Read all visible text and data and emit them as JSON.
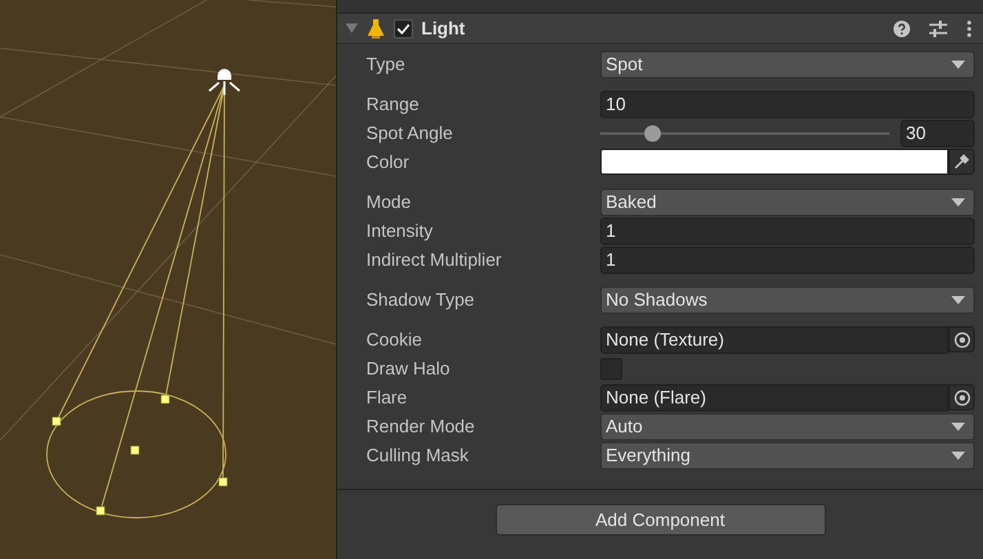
{
  "component": {
    "title": "Light",
    "enabled": true,
    "expanded": true
  },
  "groups": [
    [
      {
        "label": "Type",
        "kind": "dropdown",
        "value": "Spot"
      }
    ],
    [
      {
        "label": "Range",
        "kind": "number",
        "value": "10"
      },
      {
        "label": "Spot Angle",
        "kind": "slider",
        "value": "30",
        "level": 0.18
      },
      {
        "label": "Color",
        "kind": "color",
        "color": "#ffffff"
      }
    ],
    [
      {
        "label": "Mode",
        "kind": "dropdown",
        "value": "Baked"
      },
      {
        "label": "Intensity",
        "kind": "number",
        "value": "1"
      },
      {
        "label": "Indirect Multiplier",
        "kind": "number",
        "value": "1"
      }
    ],
    [
      {
        "label": "Shadow Type",
        "kind": "dropdown",
        "value": "No Shadows"
      }
    ],
    [
      {
        "label": "Cookie",
        "kind": "object",
        "value": "None (Texture)"
      },
      {
        "label": "Draw Halo",
        "kind": "checkbox",
        "checked": false
      },
      {
        "label": "Flare",
        "kind": "object",
        "value": "None (Flare)"
      },
      {
        "label": "Render Mode",
        "kind": "dropdown",
        "value": "Auto"
      },
      {
        "label": "Culling Mask",
        "kind": "dropdown",
        "value": "Everything"
      }
    ]
  ],
  "add_button": "Add Component"
}
